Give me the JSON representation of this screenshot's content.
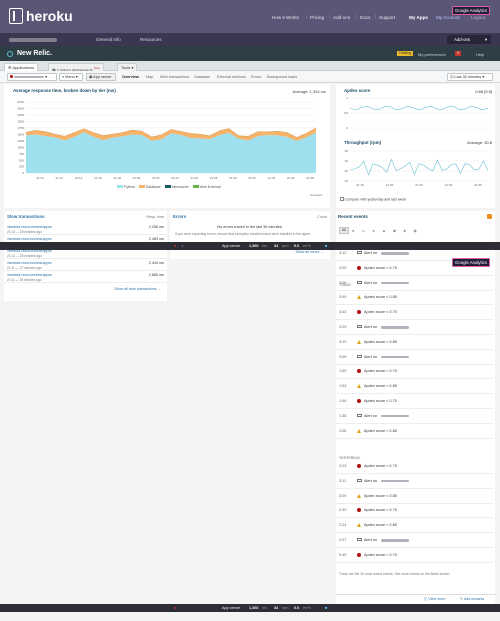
{
  "heroku": {
    "brand": "heroku",
    "nav": [
      "How it Works",
      "Pricing",
      "Add-ons",
      "Docs",
      "Support",
      "My Apps",
      "My Account",
      "Logout"
    ],
    "ga_badge": "Google Analytics"
  },
  "app_bar": {
    "general_info": "General Info",
    "resources": "Resources",
    "addons_label": "Add-ons"
  },
  "newrelic": {
    "brand": "New Relic.",
    "account_badge": "Hosting",
    "preferences": "My preferences",
    "badge_count": "2",
    "help": "Help"
  },
  "tabs": {
    "applications": "Applications",
    "custom_dashboards": "Custom dashboards",
    "new_badge": "New",
    "tools": "Tools"
  },
  "subnav": {
    "menu": "Menu",
    "app_server": "App server",
    "items": [
      "Overview",
      "Map",
      "Web transactions",
      "Database",
      "External services",
      "Errors",
      "Background tasks"
    ],
    "time_range": "Last 30 minutes"
  },
  "response_chart": {
    "title": "Average response time, broken down by tier (ms)",
    "average": "Average: 1,394 ms",
    "y_ticks": [
      "2750",
      "2500",
      "2250",
      "2000",
      "1750",
      "1500",
      "1250",
      "1000",
      "750",
      "500",
      "250",
      "0"
    ],
    "x_ticks": [
      "21:10",
      "21:12",
      "21:14",
      "21:16",
      "21:18",
      "21:20",
      "21:22",
      "21:24",
      "21:26",
      "21:28",
      "21:30",
      "21:32",
      "21:34",
      "21:36",
      "21:38"
    ],
    "legend": [
      "Python",
      "Database",
      "Memcache",
      "Web External"
    ],
    "footer": "Sampled"
  },
  "apdex": {
    "title": "Apdex score",
    "value": "0.68 [0.5]",
    "y_ticks": [
      "1",
      "0.5",
      "0"
    ]
  },
  "throughput": {
    "title": "Throughput (rpm)",
    "average": "Average: 30.8",
    "y_ticks": [
      "50",
      "40",
      "30",
      "20"
    ],
    "x_ticks": [
      "21:15",
      "21:20",
      "21:25",
      "21:30",
      "21:35"
    ],
    "compare": "Compare with yesterday and last week"
  },
  "slow_tx": {
    "title": "Slow transactions",
    "header_resp": "Resp. time",
    "items": [
      {
        "name": "/lambda-resources/wrapper",
        "time": "2,256 ms",
        "when": "21:13 — 28 minutes ago"
      },
      {
        "name": "/lambda-resources/wrapper",
        "time": "2,483 ms",
        "when": "21:12 — 26 minutes ago"
      },
      {
        "name": "/lambda-resources/wrapper",
        "time": "",
        "when": "21:12 — 26 minutes ago"
      },
      {
        "name": "/lambda-resources/wrapper",
        "time": "2,444 ms",
        "when": "21:11 — 27 minutes ago"
      },
      {
        "name": "/lambda-resources/wrapper",
        "time": "2,880 ms",
        "when": "21:11 — 28 minutes ago"
      }
    ],
    "show_all": "Show all slow transactions →"
  },
  "errors": {
    "title": "Errors",
    "count_label": "Count",
    "empty": "No errors traced in the last 30 minutes.",
    "hint": "If you were expecting errors, ensure that exception handlers have been installed in the agent",
    "show_all": "Show all errors →"
  },
  "events": {
    "title": "Recent events",
    "all_label": "All",
    "days": [
      "TODAY",
      "YESTERDAY"
    ],
    "today": [
      {
        "time": "3:12",
        "icon": "env",
        "text": "Alert on"
      },
      {
        "time": "3:09",
        "icon": "dot",
        "text": "Apdex score < 0.70"
      },
      {
        "time": "3:08",
        "icon": "env",
        "text": "Alert on"
      },
      {
        "time": "3:49",
        "icon": "tri",
        "text": "Apdex score < 0.85"
      },
      {
        "time": "3:43",
        "icon": "dot",
        "text": "Apdex score < 0.70"
      },
      {
        "time": "3:29",
        "icon": "env",
        "text": "Alert on"
      },
      {
        "time": "3:19",
        "icon": "tri",
        "text": "Apdex score < 0.85"
      },
      {
        "time": "3:09",
        "icon": "env",
        "text": "Alert on"
      },
      {
        "time": "1:59",
        "icon": "dot",
        "text": "Apdex score < 0.70"
      },
      {
        "time": "1:54",
        "icon": "tri",
        "text": "Apdex score < 0.85"
      },
      {
        "time": "1:46",
        "icon": "dot",
        "text": "Apdex score < 0.70"
      },
      {
        "time": "1:38",
        "icon": "env",
        "text": "Alert on"
      },
      {
        "time": "1:08",
        "icon": "tri",
        "text": "Apdex score < 0.85"
      }
    ],
    "yesterday": [
      {
        "time": "3:23",
        "icon": "dot",
        "text": "Apdex score < 0.70"
      },
      {
        "time": "3:11",
        "icon": "env",
        "text": "Alert on"
      },
      {
        "time": "3:09",
        "icon": "tri",
        "text": "Apdex score < 0.85"
      },
      {
        "time": "2:32",
        "icon": "dot",
        "text": "Apdex score < 0.70"
      },
      {
        "time": "2:24",
        "icon": "tri",
        "text": "Apdex score < 0.85"
      },
      {
        "time": "2:07",
        "icon": "env",
        "text": "Alert on"
      },
      {
        "time": "0:49",
        "icon": "dot",
        "text": "Apdex score < 0.70"
      }
    ],
    "footer": "These are the 20 most recent events. See more events on the Alerts screen",
    "view_more": "View more",
    "add_remarks": "Add remarks"
  },
  "status": {
    "app_server": "App server",
    "val1": "1,360",
    "unit1": "ms",
    "val2": "34",
    "unit2": "rpm",
    "val3": "0.0",
    "unit3": "err%"
  },
  "colors": {
    "heroku_bar": "#5a5676",
    "newrelic_bar": "#2f3d44",
    "python": "#9fe0ee",
    "database": "#f5b36a",
    "memcache": "#1c5b6c",
    "web_external": "#6ab04c"
  }
}
